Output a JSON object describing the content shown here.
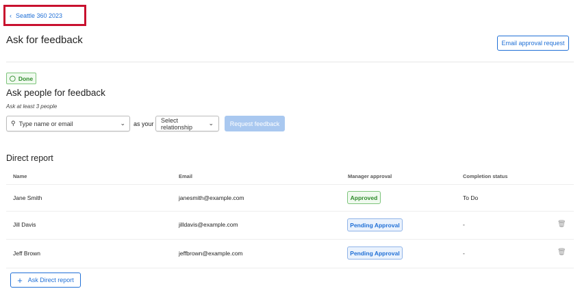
{
  "breadcrumb": {
    "label": "Seattle 360 2023"
  },
  "header": {
    "title": "Ask for feedback",
    "email_button": "Email approval request"
  },
  "status": {
    "label": "Done"
  },
  "ask": {
    "title": "Ask people for feedback",
    "hint": "Ask at least 3 people",
    "search_placeholder": "Type name or email",
    "as_your": "as your",
    "relationship_placeholder": "Select relationship",
    "request_button": "Request feedback"
  },
  "section": {
    "title": "Direct report"
  },
  "table": {
    "columns": [
      "Name",
      "Email",
      "Manager approval",
      "Completion status"
    ],
    "rows": [
      {
        "name": "Jane Smith",
        "email": "janesmith@example.com",
        "approval": "Approved",
        "status": "To Do"
      },
      {
        "name": "Jill Davis",
        "email": "jilldavis@example.com",
        "approval": "Pending Approval",
        "status": "-"
      },
      {
        "name": "Jeff Brown",
        "email": "jeffbrown@example.com",
        "approval": "Pending Approval",
        "status": "-"
      }
    ]
  },
  "add_button": "Ask Direct report"
}
